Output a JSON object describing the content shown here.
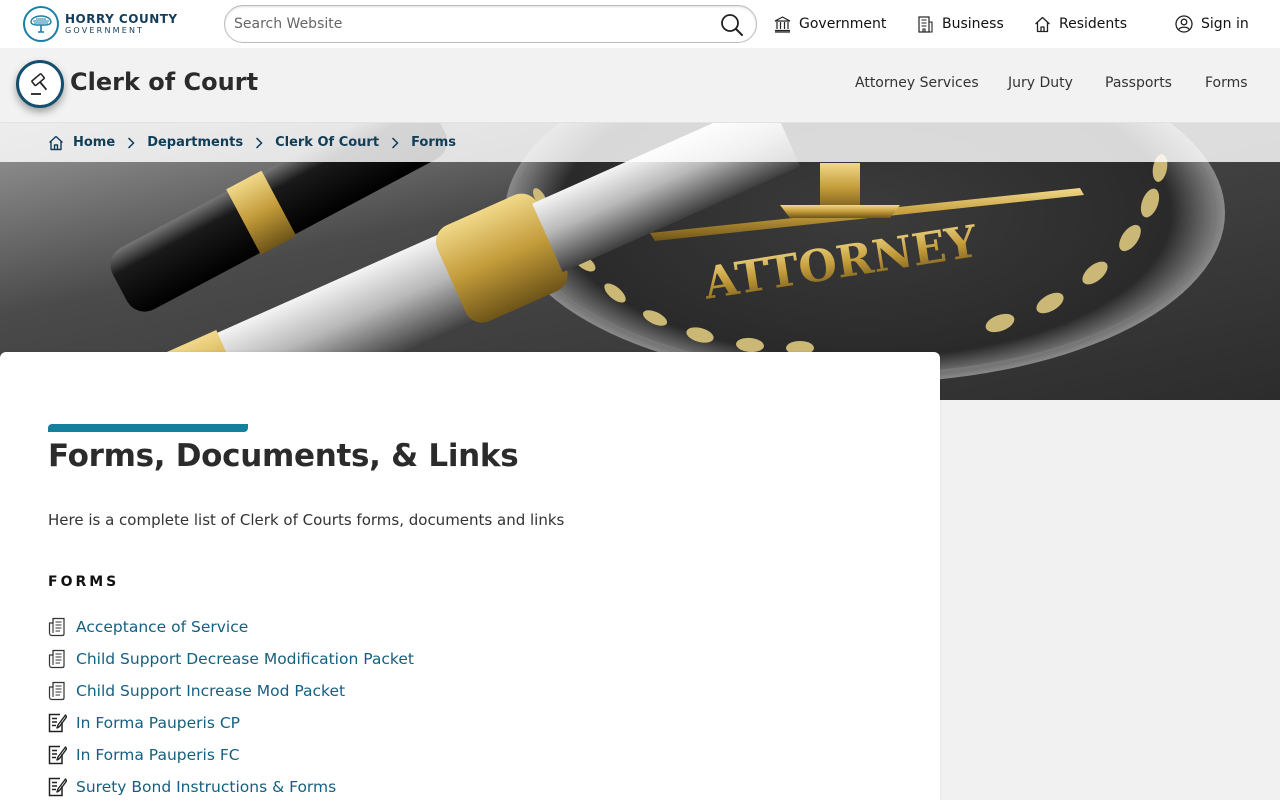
{
  "brand": {
    "line1": "HORRY COUNTY",
    "line2": "GOVERNMENT"
  },
  "search": {
    "placeholder": "Search Website"
  },
  "topnav": {
    "government": "Government",
    "business": "Business",
    "residents": "Residents",
    "signin": "Sign in"
  },
  "department": {
    "title": "Clerk of Court",
    "nav": [
      "Attorney Services",
      "Jury Duty",
      "Passports",
      "Forms"
    ]
  },
  "breadcrumb": [
    "Home",
    "Departments",
    "Clerk Of Court",
    "Forms"
  ],
  "hero": {
    "seal_text": "ATTORNEY"
  },
  "content": {
    "title": "Forms, Documents, & Links",
    "intro": "Here is a complete list of Clerk of Courts forms, documents and links",
    "section": "FORMS",
    "items": [
      {
        "label": "Acceptance of Service",
        "icon": "document-icon"
      },
      {
        "label": "Child Support Decrease Modification Packet",
        "icon": "document-icon"
      },
      {
        "label": "Child Support Increase Mod Packet",
        "icon": "document-icon"
      },
      {
        "label": "In Forma Pauperis CP",
        "icon": "fillable-form-icon"
      },
      {
        "label": "In Forma Pauperis FC",
        "icon": "fillable-form-icon"
      },
      {
        "label": "Surety Bond Instructions & Forms",
        "icon": "fillable-form-icon"
      }
    ]
  },
  "colors": {
    "accent": "#14809e",
    "link": "#155f80",
    "brand_dark": "#123d57"
  }
}
